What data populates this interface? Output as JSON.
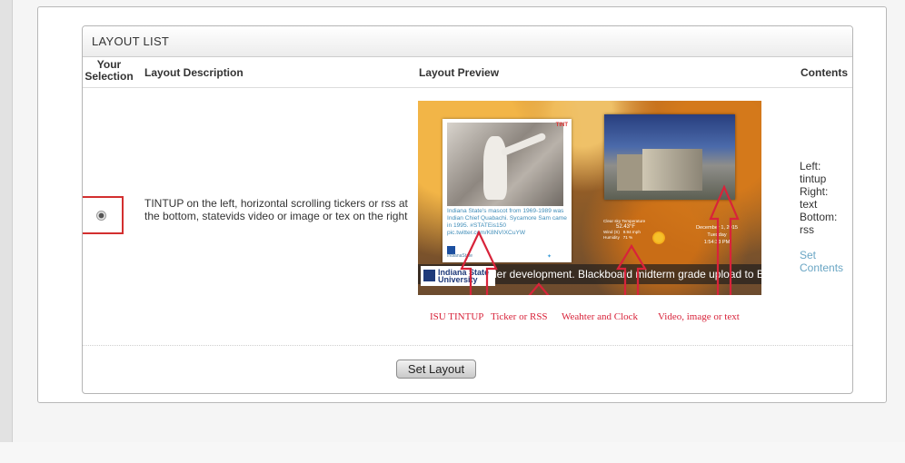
{
  "panel": {
    "title": "LAYOUT LIST"
  },
  "columns": {
    "selection": "Your Selection",
    "description": "Layout Description",
    "preview": "Layout Preview",
    "contents": "Contents"
  },
  "layout": {
    "selected": true,
    "description": "TINTUP on the left, horizontal scrolling tickers or rss at the bottom, statevids video or image or tex on the right",
    "contents": [
      "Left:",
      "tintup",
      "Right:",
      "text",
      "Bottom:",
      "rss"
    ],
    "set_contents_label": "Set Contents",
    "preview": {
      "tint_post": "Indiana State's mascot from 1969-1989 was Indian Chief Quabachi. Sycamore Sam came in 1995. #STATEis150 pic.twitter.com/K8NVIXCuYW",
      "tint_brand": "TINT",
      "tint_author": "IndianaState",
      "weather": {
        "condition": "Clear sky",
        "temp_label": "Temperature",
        "temp": "52.43°F",
        "wind_label": "Wind (S)",
        "wind": "9.94 mph",
        "humidity_label": "Humidity",
        "humidity": "71 %"
      },
      "clock": {
        "date": "December 1, 2015",
        "day": "Tuesday",
        "time": "1:54:33 PM"
      },
      "ticker": "der development.   Blackboard midterm grade upload to Ban",
      "logo": "Indiana State University"
    },
    "annotations": [
      "ISU TINTUP",
      "Ticker or RSS",
      "Weahter and Clock",
      "Video, image or text"
    ]
  },
  "actions": {
    "set_layout": "Set Layout"
  },
  "colors": {
    "annotation": "#d8233a",
    "link": "#6aa6c4",
    "highlight_box": "#d32f2f"
  }
}
